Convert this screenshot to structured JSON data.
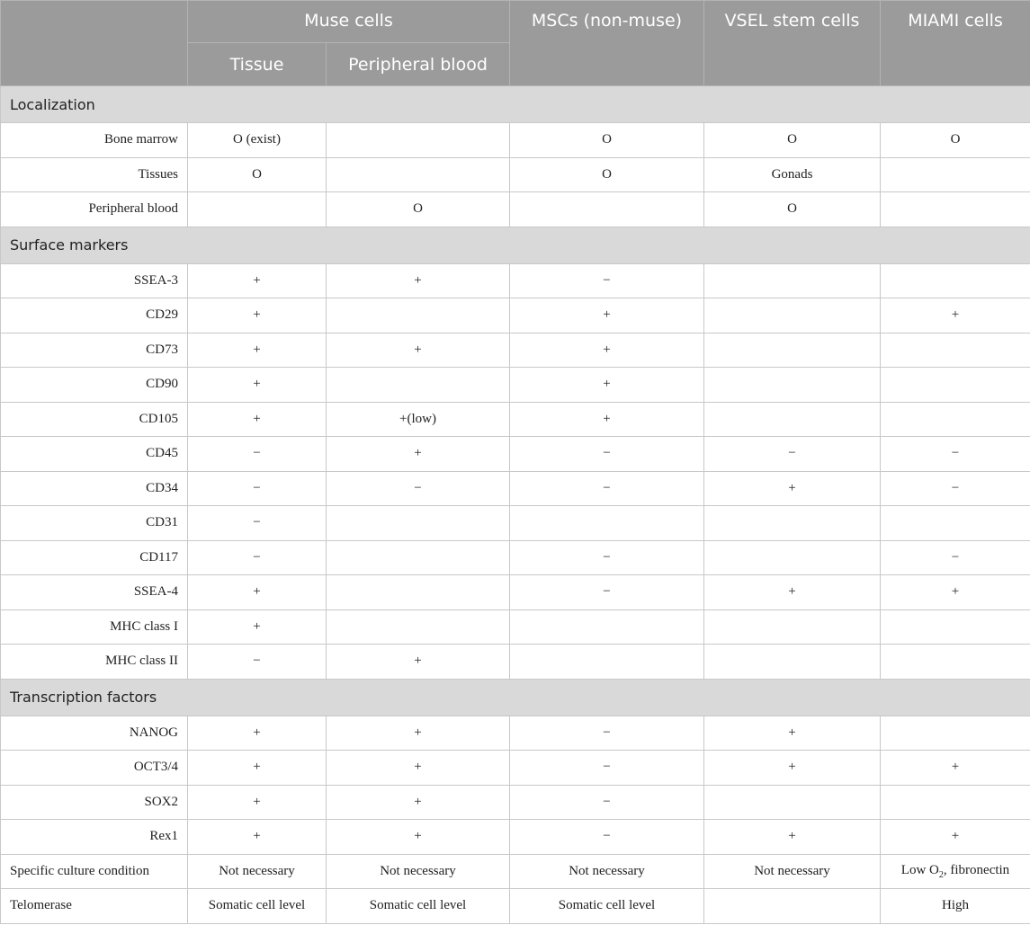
{
  "header": {
    "corner": "",
    "muse": "Muse cells",
    "muse_tissue": "Tissue",
    "muse_blood": "Peripheral blood",
    "mscs": "MSCs (non-muse)",
    "vsel": "VSEL stem cells",
    "miami": "MIAMI cells"
  },
  "sections": [
    {
      "title": "Localization",
      "rows": [
        {
          "label": "Bone marrow",
          "cells": [
            "O (exist)",
            "",
            "O",
            "O",
            "O"
          ]
        },
        {
          "label": "Tissues",
          "cells": [
            "O",
            "",
            "O",
            "Gonads",
            ""
          ]
        },
        {
          "label": "Peripheral blood",
          "cells": [
            "",
            "O",
            "",
            "O",
            ""
          ]
        }
      ]
    },
    {
      "title": "Surface markers",
      "rows": [
        {
          "label": "SSEA-3",
          "cells": [
            "+",
            "+",
            "−",
            "",
            ""
          ]
        },
        {
          "label": "CD29",
          "cells": [
            "+",
            "",
            "+",
            "",
            "+"
          ]
        },
        {
          "label": "CD73",
          "cells": [
            "+",
            "+",
            "+",
            "",
            ""
          ]
        },
        {
          "label": "CD90",
          "cells": [
            "+",
            "",
            "+",
            "",
            ""
          ]
        },
        {
          "label": "CD105",
          "cells": [
            "+",
            "+(low)",
            "+",
            "",
            ""
          ]
        },
        {
          "label": "CD45",
          "cells": [
            "−",
            "+",
            "−",
            "−",
            "−"
          ]
        },
        {
          "label": "CD34",
          "cells": [
            "−",
            "−",
            "−",
            "+",
            "−"
          ]
        },
        {
          "label": "CD31",
          "cells": [
            "−",
            "",
            "",
            "",
            ""
          ]
        },
        {
          "label": "CD117",
          "cells": [
            "−",
            "",
            "−",
            "",
            "−"
          ]
        },
        {
          "label": "SSEA-4",
          "cells": [
            "+",
            "",
            "−",
            "+",
            "+"
          ]
        },
        {
          "label": "MHC class I",
          "cells": [
            "+",
            "",
            "",
            "",
            ""
          ]
        },
        {
          "label": "MHC class II",
          "cells": [
            "−",
            "+",
            "",
            "",
            ""
          ]
        }
      ]
    },
    {
      "title": "Transcription factors",
      "rows": [
        {
          "label": "NANOG",
          "cells": [
            "+",
            "+",
            "−",
            "+",
            ""
          ]
        },
        {
          "label": "OCT3/4",
          "cells": [
            "+",
            "+",
            "−",
            "+",
            "+"
          ]
        },
        {
          "label": "SOX2",
          "cells": [
            "+",
            "+",
            "−",
            "",
            ""
          ]
        },
        {
          "label": "Rex1",
          "cells": [
            "+",
            "+",
            "−",
            "+",
            "+"
          ]
        }
      ]
    }
  ],
  "footer_rows": [
    {
      "label": "Specific culture condition",
      "cells": [
        "Not necessary",
        "Not necessary",
        "Not necessary",
        "Not necessary",
        "Low O2, fibronectin"
      ]
    },
    {
      "label": "Telomerase",
      "cells": [
        "Somatic cell level",
        "Somatic cell level",
        "Somatic cell level",
        "",
        "High"
      ]
    }
  ],
  "miami_culture_prefix": "Low O",
  "miami_culture_sub": "2",
  "miami_culture_suffix": ", fibronectin"
}
